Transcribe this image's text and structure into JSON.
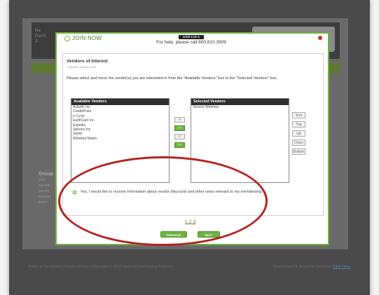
{
  "background": {
    "logo_lines": [
      "Na",
      "Purch",
      "P"
    ],
    "side_heading": "Group",
    "side_lines": [
      "Join",
      "membe",
      "purcha",
      "membe",
      "from t"
    ],
    "footer_left": "Terms & Conditions | Privacy Policy | Copyright © 2013 National Purchasing Partners",
    "footer_right": "Government & Nonprofit Members",
    "footer_link": "Click Here"
  },
  "modal": {
    "title": "JOIN NOW",
    "step": "STEP 6 OF 6",
    "help": "For help, please call 800.810.3909"
  },
  "section": {
    "title": "Vendors of Interest",
    "required_note": "* Signifies required field",
    "instructions": "Please select and move the vendor(s) you are interested in from the \"Available Vendors\" box to the \"Selected Vendors\" box."
  },
  "available": {
    "header": "Available Vendors",
    "items": [
      "Actsoft, Inc.",
      "CradlePoint",
      "e-Cycle",
      "EarthCam Inc",
      "Expedia",
      "Spireon Inc",
      "Vantiv",
      "Wireless Matrix"
    ]
  },
  "selected": {
    "header": "Selected Vendors",
    "items": [
      "Verizon Wireless"
    ]
  },
  "move_buttons": [
    ">",
    ">>",
    "<",
    "<<"
  ],
  "sort_buttons": [
    "Sort",
    "Top",
    "Up",
    "Down",
    "Bottom"
  ],
  "consent": {
    "checked": true,
    "text": "Yes, I would like to receive information about vendor discounts and other news relevant to my membership."
  },
  "pager": "1 2 3",
  "nav": {
    "previous": "PREVIOUS",
    "next": "NEXT"
  },
  "colors": {
    "accent": "#6db33f",
    "annotation": "#b3231f"
  }
}
